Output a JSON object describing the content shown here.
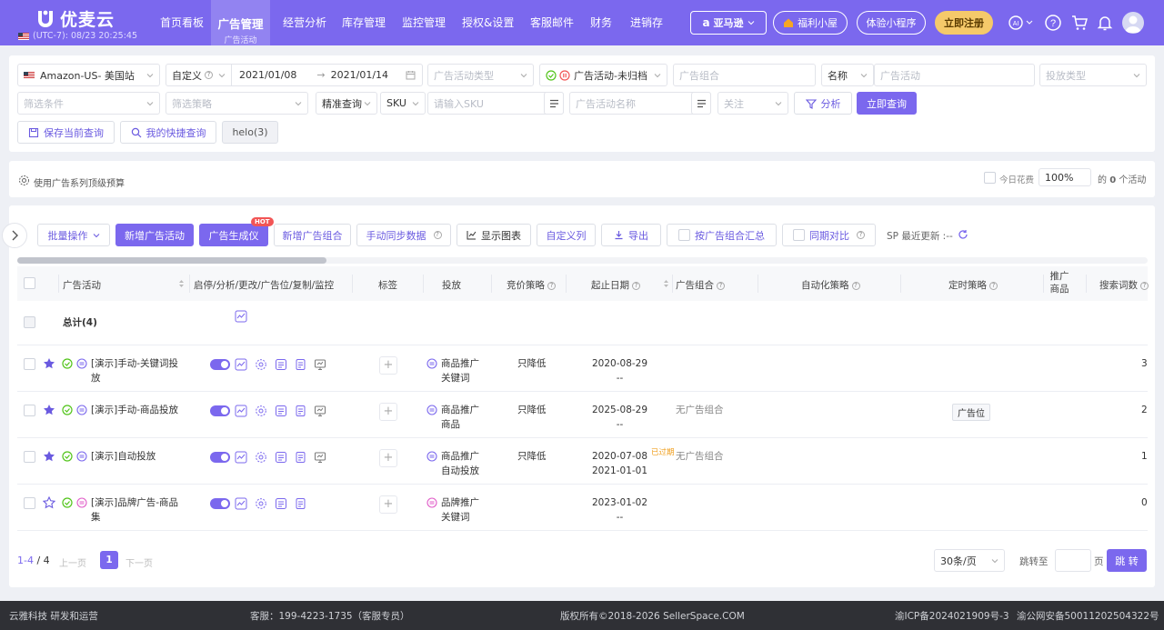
{
  "header": {
    "brand": "优麦云",
    "timezone": "(UTC-7): 08/23 20:25:45",
    "nav": [
      "首页看板",
      "经营分析",
      "库存管理",
      "监控管理",
      "授权&设置",
      "客服邮件",
      "财务",
      "进销存"
    ],
    "active_nav": {
      "label": "广告管理",
      "sub": "广告活动"
    },
    "platform": "亚马逊",
    "welfare": "福利小屋",
    "miniapp": "体验小程序",
    "register": "立即注册",
    "ai_label": "AI"
  },
  "filters": {
    "marketplace": "Amazon-US- 美国站",
    "date_mode": "自定义",
    "date_start": "2021/01/08",
    "date_end": "2021/01/14",
    "campaign_type_ph": "广告活动类型",
    "status": "广告活动-未归档",
    "portfolio_ph": "广告组合",
    "search_field": "名称",
    "campaign_search_ph": "广告活动",
    "targeting_type_ph": "投放类型",
    "conditions_ph": "筛选条件",
    "strategy_ph": "筛选策略",
    "match_mode": "精准查询",
    "sku_field": "SKU",
    "sku_ph": "请输入SKU",
    "campaign_name_ph": "广告活动名称",
    "follow_ph": "关注",
    "analyze": "分析",
    "query": "立即查询",
    "save_query": "保存当前查询",
    "my_queries": "我的快捷查询",
    "saved_tag": "helo(3)"
  },
  "budget_bar": {
    "label": "使用广告系列顶级预算",
    "today_spend": "今日花费",
    "percent": "100%",
    "suffix_pre": "的",
    "count": "0",
    "suffix_post": "个活动"
  },
  "toolbar": {
    "bulk": "批量操作",
    "new_campaign": "新增广告活动",
    "ad_generator": "广告生成仪",
    "hot": "HOT",
    "new_portfolio": "新增广告组合",
    "manual_sync": "手动同步数据",
    "show_chart": "显示图表",
    "custom_cols": "自定义列",
    "export": "导出",
    "group_by_portfolio": "按广告组合汇总",
    "yoy": "同期对比",
    "last_update": "SP 最近更新 :--"
  },
  "table": {
    "columns": [
      "广告活动",
      "启停/分析/更改/广告位/复制/监控",
      "标签",
      "投放",
      "竞价策略",
      "起止日期",
      "广告组合",
      "自动化策略",
      "定时策略",
      "推广商品",
      "搜索词数"
    ],
    "total_label": "总计(4)",
    "rows": [
      {
        "name": [
          "[演示]手动-关键词投",
          "放"
        ],
        "star": true,
        "type_icon": "SP",
        "targeting": [
          "商品推广",
          "关键词"
        ],
        "bid": "只降低",
        "start": "2020-08-29",
        "end": "--",
        "portfolio": "",
        "expired": "",
        "placement": "",
        "search_terms": "3"
      },
      {
        "name": [
          "[演示]手动-商品投放"
        ],
        "star": true,
        "type_icon": "SP",
        "targeting": [
          "商品推广",
          "商品"
        ],
        "bid": "只降低",
        "start": "2025-08-29",
        "end": "--",
        "portfolio": "无广告组合",
        "expired": "",
        "placement": "广告位",
        "search_terms": "2"
      },
      {
        "name": [
          "[演示]自动投放"
        ],
        "star": true,
        "type_icon": "SP",
        "targeting": [
          "商品推广",
          "自动投放"
        ],
        "bid": "只降低",
        "start": "2020-07-08",
        "end": "2021-01-01",
        "portfolio": "无广告组合",
        "expired": "已过期",
        "placement": "",
        "search_terms": "1"
      },
      {
        "name": [
          "[演示]品牌广告-商品",
          "集"
        ],
        "star": false,
        "type_icon": "SB",
        "targeting": [
          "品牌推广",
          "关键词"
        ],
        "bid": "",
        "start": "2023-01-02",
        "end": "--",
        "portfolio": "",
        "expired": "",
        "placement": "",
        "search_terms": "0"
      }
    ]
  },
  "pagination": {
    "range": "1-4",
    "total": "4",
    "prev": "上一页",
    "page": "1",
    "next": "下一页",
    "page_size": "30条/页",
    "jump_to": "跳转至",
    "page_unit": "页",
    "go": "跳 转"
  },
  "footer": {
    "company": "云雅科技 研发和运营",
    "service": "客服：199-4223-1735（客服专员）",
    "copyright": "版权所有©2018-2026 SellerSpace.COM",
    "icp": "渝ICP备2024021909号-3",
    "police": "渝公网安备50011202504322号"
  },
  "colors": {
    "brand": "#7b68ee",
    "success": "#52c41a",
    "danger": "#f25555",
    "warning": "#f0a020",
    "footer_bg": "#2f3035"
  }
}
